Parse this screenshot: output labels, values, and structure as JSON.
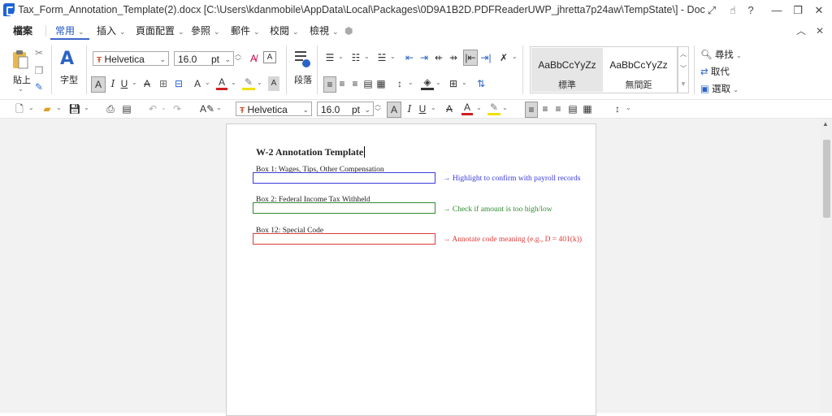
{
  "titlebar": {
    "title": "Tax_Form_Annotation_Template(2).docx [C:\\Users\\kdanmobile\\AppData\\Local\\Packages\\0D9A1B2D.PDFReaderUWP_jhretta7p24aw\\TempState\\] - Doc",
    "help_label": "?"
  },
  "menu": {
    "items": [
      "檔案",
      "常用",
      "插入",
      "頁面配置",
      "參照",
      "郵件",
      "校閱",
      "檢視"
    ]
  },
  "ribbon": {
    "paste_label": "貼上",
    "font_group_label": "字型",
    "paragraph_label": "段落",
    "font_name": "Helvetica",
    "font_size": "16.0",
    "font_unit": "pt",
    "styles": [
      {
        "sample": "AaBbCcYyZz",
        "name": "標準"
      },
      {
        "sample": "AaBbCcYyZz",
        "name": "無間距"
      }
    ],
    "find_label": "尋找",
    "replace_label": "取代",
    "select_label": "選取"
  },
  "quick_toolbar": {
    "font_name": "Helvetica",
    "font_size": "16.0",
    "font_unit": "pt"
  },
  "document": {
    "title": "W-2 Annotation Template",
    "fields": [
      {
        "label": "Box 1: Wages, Tips, Other Compensation",
        "note": "→ Highlight to confirm with payroll records",
        "color": "#3a3ae0"
      },
      {
        "label": "Box 2: Federal Income Tax Withheld",
        "note": "→ Check if amount is too high/low",
        "color": "#2e8b2e"
      },
      {
        "label": "Box 12: Special Code",
        "note": "→ Annotate code meaning (e.g., D = 401(k))",
        "color": "#e03a3a"
      }
    ]
  }
}
